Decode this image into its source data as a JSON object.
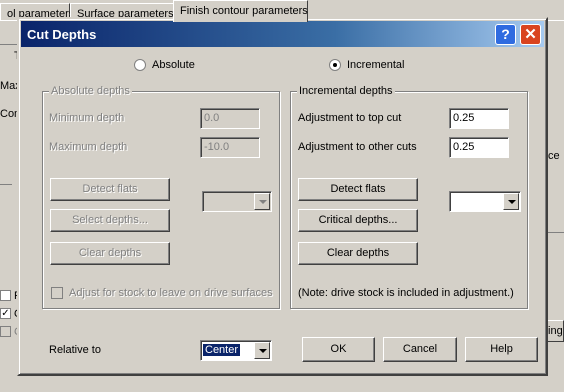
{
  "background": {
    "tabs": [
      "ol parameters",
      "Surface parameters",
      "Finish contour parameters"
    ],
    "fragments": [
      "T",
      "Maxi",
      "Com",
      "ce",
      "R",
      "O",
      "C",
      "ting"
    ]
  },
  "dialog": {
    "title": "Cut Depths",
    "help_glyph": "?",
    "close_glyph": "✕",
    "mode": {
      "absolute_label": "Absolute",
      "incremental_label": "Incremental",
      "selected": "Incremental"
    },
    "absolute_group": {
      "title": "Absolute depths",
      "min_label": "Minimum depth",
      "min_value": "0.0",
      "max_label": "Maximum depth",
      "max_value": "-10.0",
      "detect_flats": "Detect flats",
      "select_depths": "Select depths...",
      "clear_depths": "Clear depths",
      "adjust_stock": "Adjust for stock to leave on drive surfaces"
    },
    "incremental_group": {
      "title": "Incremental depths",
      "top_cut_label": "Adjustment to top cut",
      "top_cut_value": "0.25",
      "other_cuts_label": "Adjustment to other cuts",
      "other_cuts_value": "0.25",
      "detect_flats": "Detect flats",
      "critical_depths": "Critical depths...",
      "clear_depths": "Clear depths",
      "note": "(Note:  drive stock is included in adjustment.)"
    },
    "relative_to": {
      "label": "Relative to",
      "value": "Center"
    },
    "buttons": {
      "ok": "OK",
      "cancel": "Cancel",
      "help": "Help"
    }
  }
}
